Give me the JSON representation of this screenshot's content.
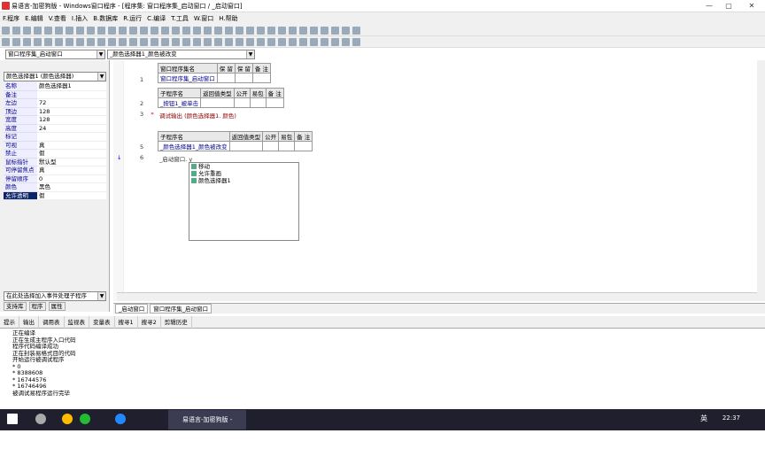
{
  "title": "易语言-加密狗版 - Windows窗口程序 - [程序集: 窗口程序集_启动窗口 / _启动窗口]",
  "menu": [
    "F.程序",
    "E.编辑",
    "V.查看",
    "I.插入",
    "B.数据库",
    "R.运行",
    "C.编译",
    "T.工具",
    "W.窗口",
    "H.帮助"
  ],
  "combo_left": "窗口程序集_启动窗口",
  "combo_right": "_颜色选择器1_颜色被改变",
  "comp_select": "颜色选择器1 (颜色选择器)",
  "props": [
    {
      "k": "名称",
      "v": "颜色选择器1"
    },
    {
      "k": "备注",
      "v": ""
    },
    {
      "k": "左边",
      "v": "72"
    },
    {
      "k": "顶边",
      "v": "128"
    },
    {
      "k": "宽度",
      "v": "128"
    },
    {
      "k": "高度",
      "v": "24"
    },
    {
      "k": "标记",
      "v": ""
    },
    {
      "k": "可视",
      "v": "真"
    },
    {
      "k": "禁止",
      "v": "假"
    },
    {
      "k": "鼠标指针",
      "v": "默认型"
    },
    {
      "k": "可停留焦点",
      "v": "真"
    },
    {
      "k": "停留顺序",
      "v": "0"
    },
    {
      "k": "颜色",
      "v": "黑色"
    },
    {
      "k": "允许透明",
      "v": "假"
    }
  ],
  "event_select": "在此处选择加入事件处理子程序",
  "left_tabs": [
    "支持库",
    "程序",
    "属性"
  ],
  "code": {
    "t1_h": [
      "窗口程序集名",
      "保 留",
      "保 留",
      "备 注"
    ],
    "t1_d": "窗口程序集_启动窗口",
    "t2_h": [
      "子程序名",
      "返回值类型",
      "公开",
      "易包",
      "备 注"
    ],
    "t2_d": "_按钮1_被单击",
    "line3": "调试输出 (颜色选择器1. 颜色)",
    "t3_h": [
      "子程序名",
      "返回值类型",
      "公开",
      "易包",
      "备 注"
    ],
    "t3_d": "_颜色选择器1_颜色被改变",
    "line6": "_启动窗口. y",
    "lines": [
      "1",
      "2",
      "3",
      "5",
      "6"
    ]
  },
  "popup": [
    "移动",
    "允许重画",
    "颜色选择器1"
  ],
  "bottom_tabs": [
    "_启动窗口",
    "窗口程序集_启动窗口"
  ],
  "out_tabs": [
    "提示",
    "输出",
    "调用表",
    "监视表",
    "变量表",
    "搜寻1",
    "搜寻2",
    "剪辑历史"
  ],
  "output": [
    "正在编译",
    "正在生成主程序入口代码",
    "程序代码编译成功",
    "正在封装易格式目的代码",
    "开始运行被调试程序",
    "* 0",
    "* 8388608",
    "* 16744576",
    "* 16746496",
    "被调试易程序运行完毕"
  ],
  "taskbar": {
    "app": "易语言-加密狗版 - Wi...",
    "lang": "英",
    "time": "22:37"
  }
}
